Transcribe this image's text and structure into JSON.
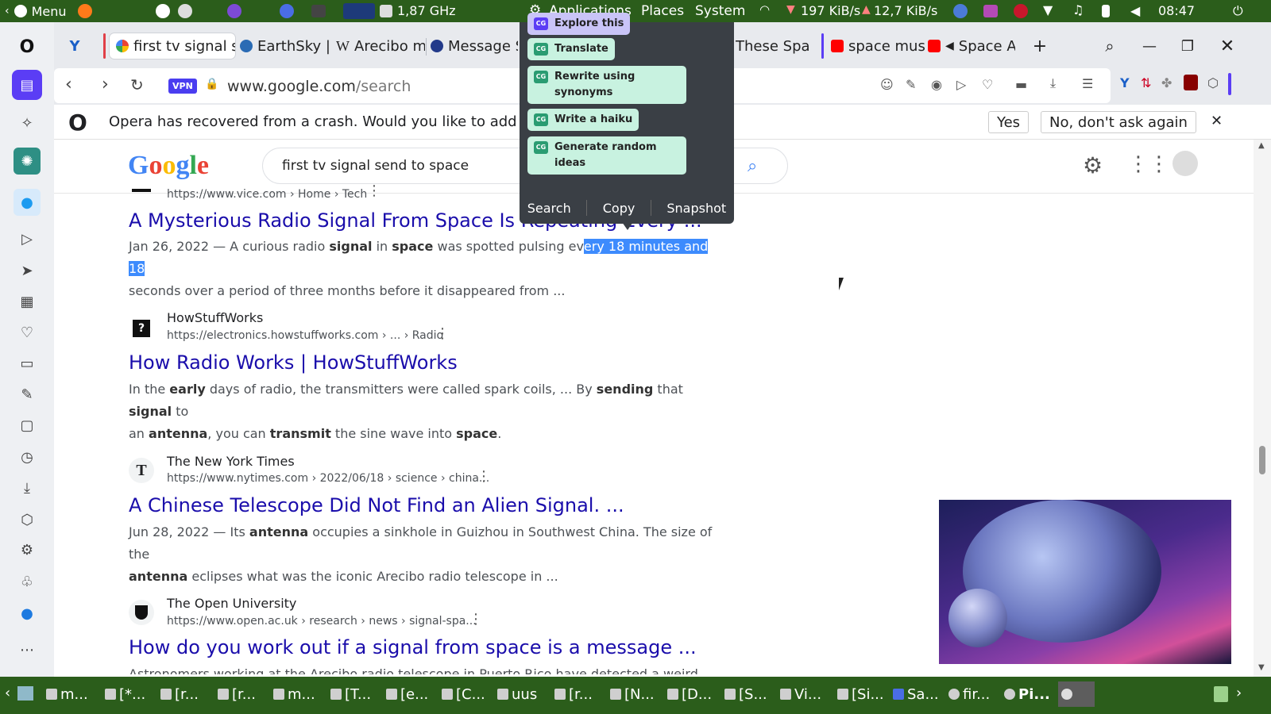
{
  "os_top": {
    "menu_label": "Menu",
    "cpu_freq": "1,87 GHz",
    "apps": "Applications",
    "places": "Places",
    "system": "System",
    "net_down": "197 KiB/s",
    "net_up": "12,7 KiB/s",
    "clock": "08:47"
  },
  "tabs": [
    {
      "label": "first tv signal s",
      "active": true
    },
    {
      "label": "EarthSky |"
    },
    {
      "label": "Arecibo m"
    },
    {
      "label": "Message S"
    },
    {
      "label": "These Spa"
    },
    {
      "label": "space mus"
    },
    {
      "label": "Space A"
    }
  ],
  "address": {
    "vpn": "VPN",
    "host": "www.google.com",
    "path": "/search"
  },
  "crash_bar": {
    "message": "Opera has recovered from a crash. Would you like to add some",
    "yes": "Yes",
    "no": "No, don't ask again"
  },
  "search": {
    "logo": "Google",
    "query": "first tv signal send to space"
  },
  "popup": {
    "top_partial": "Explore this",
    "items": [
      "Translate",
      "Rewrite using synonyms",
      "Write a haiku",
      "Generate random ideas"
    ],
    "actions": [
      "Search",
      "Copy",
      "Snapshot"
    ],
    "badge": "CG"
  },
  "results": [
    {
      "site": "",
      "url": "https://www.vice.com › Home › Tech",
      "title": "A Mysterious Radio Signal From Space Is Repeating Every ...",
      "snippet_before": "Jan 26, 2022 — A curious radio ",
      "snippet_b1": "signal",
      "snippet_mid1": " in ",
      "snippet_b2": "space",
      "snippet_mid2": " was spotted pulsing ev",
      "snippet_highlight": "ery 18 minutes and 18",
      "snippet_line2": "seconds over a period of three months before it disappeared from ..."
    },
    {
      "site": "HowStuffWorks",
      "url": "https://electronics.howstuffworks.com › ... › Radio",
      "title": "How Radio Works | HowStuffWorks",
      "snip_1": "In the ",
      "snip_b1": "early",
      "snip_2": " days of radio, the transmitters were called spark coils, ... By ",
      "snip_b2": "sending",
      "snip_3": " that ",
      "snip_b3": "signal",
      "snip_4": " to",
      "snip_5": "an ",
      "snip_b4": "antenna",
      "snip_6": ", you can ",
      "snip_b5": "transmit",
      "snip_7": " the sine wave into ",
      "snip_b6": "space",
      "snip_8": "."
    },
    {
      "site": "The New York Times",
      "url": "https://www.nytimes.com › 2022/06/18 › science › china...",
      "title": "A Chinese Telescope Did Not Find an Alien Signal. ...",
      "snip_1": "Jun 28, 2022 — Its ",
      "snip_b1": "antenna",
      "snip_2": " occupies a sinkhole in Guizhou in Southwest China. The size of the",
      "snip_b2": "antenna",
      "snip_3": " eclipses what was the iconic Arecibo radio telescope in ..."
    },
    {
      "site": "The Open University",
      "url": "https://www.open.ac.uk › research › news › signal-spa...",
      "title": "How do you work out if a signal from space is a message ...",
      "snippet": "Astronomers working at the Arecibo radio telescope in Puerto Rico have detected a weird radio"
    }
  ],
  "taskbar": [
    "m...",
    "[*...",
    "[r...",
    "[r...",
    "m...",
    "[T...",
    "[e...",
    "[C...",
    "uus",
    "[r...",
    "[N...",
    "[D...",
    "[S...",
    "Vi...",
    "[Si...",
    "Sa...",
    "fir...",
    "Pi..."
  ],
  "colors": {
    "os_panel": "#2b5d1b",
    "link": "#1a0dab",
    "opera_accent": "#5b3df5",
    "highlight": "#3d8bfd",
    "popup_item": "#c8f2e0"
  }
}
